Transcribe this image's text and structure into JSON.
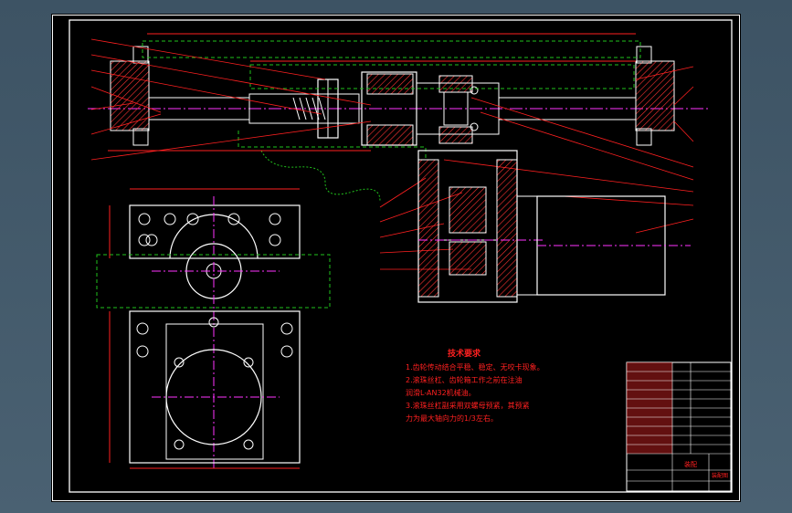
{
  "drawing": {
    "tech_title": "技术要求",
    "notes": [
      "1.齿轮传动结合平稳、稳定、无咬卡现象。",
      "2.滚珠丝杠、齿轮箱工作之前在注油",
      "   润滑L-AN32机械油。",
      "3.滚珠丝杠副采用双螺母预紧，其预紧",
      "   力为最大轴向力的1/3左右。"
    ]
  },
  "title_block": {
    "name": "装配",
    "drawing_label": "装配图"
  },
  "colors": {
    "sheet": "#000000",
    "outline": "#ffffff",
    "dimension": "#ff2020",
    "hidden": "#21c21c",
    "center": "#ff33ff",
    "hatch": "#ff3333"
  }
}
